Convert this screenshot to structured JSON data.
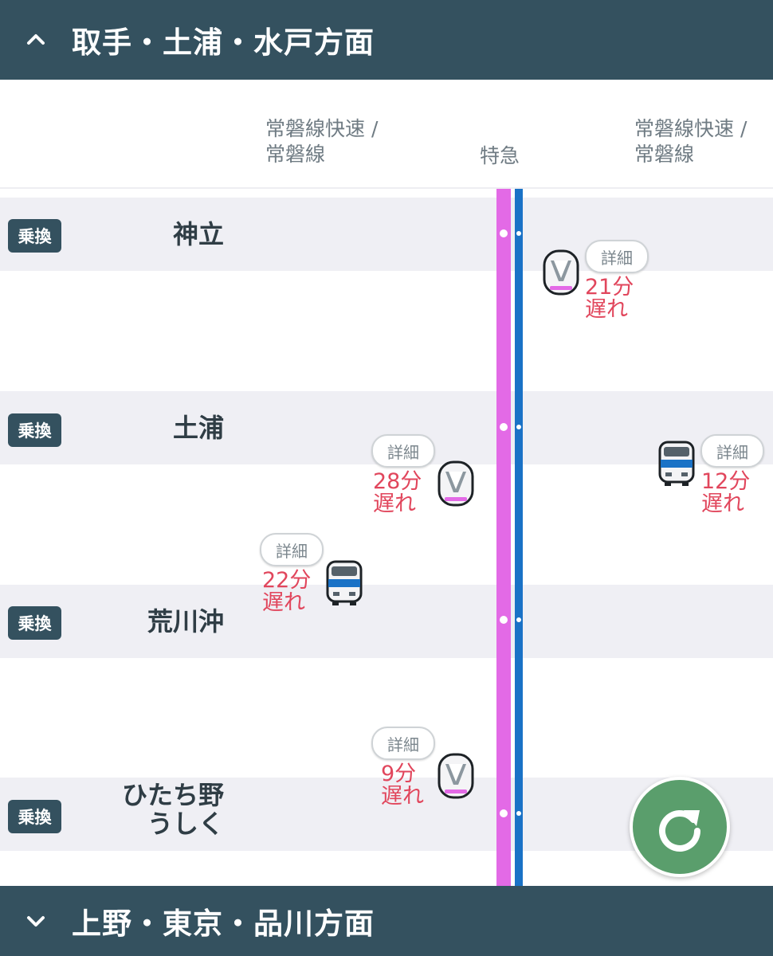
{
  "header": {
    "title": "取手・土浦・水戸方面",
    "icon": "chevron-up-icon"
  },
  "footer": {
    "title": "上野・東京・品川方面",
    "icon": "chevron-down-icon"
  },
  "columns": {
    "left": [
      "常磐線快速 /",
      "常磐線"
    ],
    "center": "特急",
    "right": [
      "常磐線快速 /",
      "常磐線"
    ]
  },
  "colors": {
    "header_bg": "#34515f",
    "express_line": "#e36ae6",
    "local_line": "#1a72c6",
    "delay_text": "#e1465c",
    "refresh_button": "#5a9e6c"
  },
  "transfer_label": "乗換",
  "stations": [
    {
      "name": "神立",
      "transfer": true
    },
    {
      "name": "土浦",
      "transfer": true
    },
    {
      "name": "荒川沖",
      "transfer": true
    },
    {
      "name": "ひたち野\nうしく",
      "name_line1": "ひたち野",
      "name_line2": "うしく",
      "transfer": true
    }
  ],
  "trains": [
    {
      "type": "express",
      "direction": "right",
      "detail_label": "詳細",
      "delay_minutes": "21分",
      "delay_text": "遅れ",
      "icon": "express-train-icon"
    },
    {
      "type": "express",
      "direction": "left",
      "detail_label": "詳細",
      "delay_minutes": "28分",
      "delay_text": "遅れ",
      "icon": "express-train-icon"
    },
    {
      "type": "local",
      "direction": "right",
      "detail_label": "詳細",
      "delay_minutes": "12分",
      "delay_text": "遅れ",
      "icon": "local-train-icon"
    },
    {
      "type": "local",
      "direction": "left",
      "detail_label": "詳細",
      "delay_minutes": "22分",
      "delay_text": "遅れ",
      "icon": "local-train-icon"
    },
    {
      "type": "express",
      "direction": "left",
      "detail_label": "詳細",
      "delay_minutes": "9分",
      "delay_text": "遅れ",
      "icon": "express-train-icon"
    }
  ],
  "refresh_button": {
    "icon": "refresh-icon"
  }
}
